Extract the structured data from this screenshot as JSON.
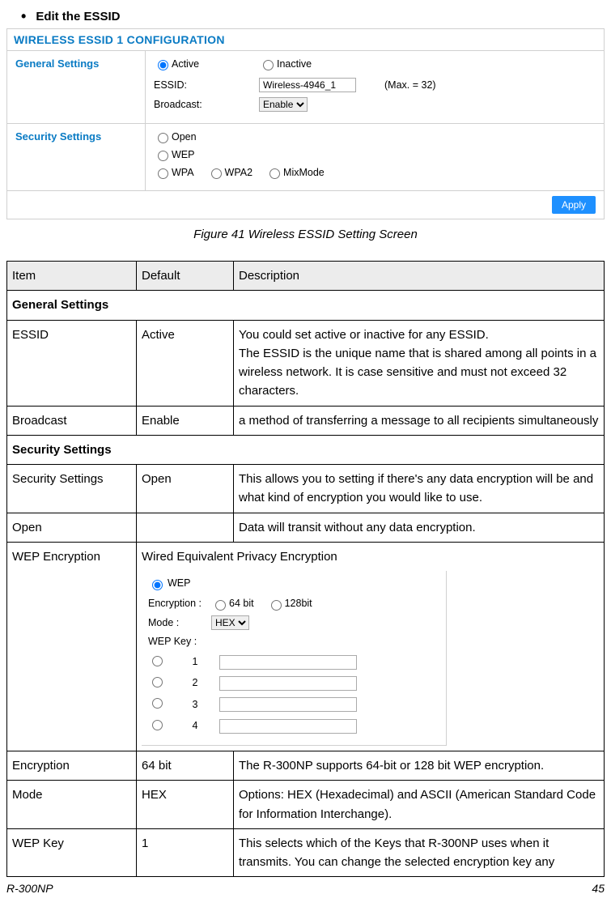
{
  "page": {
    "heading": "Edit the ESSID",
    "panelTitle": "WIRELESS ESSID 1 CONFIGURATION",
    "figureCaption": "Figure 41 Wireless ESSID Setting Screen",
    "footerLeft": "R-300NP",
    "footerRight": "45"
  },
  "settings": {
    "general": {
      "section": "General Settings",
      "activeLabel": "Active",
      "inactiveLabel": "Inactive",
      "essidLabel": "ESSID:",
      "essidValue": "Wireless-4946_1",
      "essidHint": "(Max. = 32)",
      "broadcastLabel": "Broadcast:",
      "broadcastValue": "Enable"
    },
    "security": {
      "section": "Security Settings",
      "open": "Open",
      "wep": "WEP",
      "wpa": "WPA",
      "wpa2": "WPA2",
      "mix": "MixMode"
    },
    "applyLabel": "Apply"
  },
  "table": {
    "headers": {
      "item": "Item",
      "default": "Default",
      "desc": "Description"
    },
    "generalSection": "General Settings",
    "rows": {
      "essid": {
        "item": "ESSID",
        "def": "Active",
        "desc": "You could set active or inactive for any ESSID.\nThe ESSID is the unique name that is shared among all points in a wireless network. It is case sensitive and must not exceed 32 characters."
      },
      "broadcast": {
        "item": "Broadcast",
        "def": "Enable",
        "desc": "a method of transferring a message to all recipients simultaneously"
      }
    },
    "securitySection": "Security Settings",
    "secRows": {
      "sec": {
        "item": "Security Settings",
        "def": "Open",
        "desc": "This allows you to setting if there's any data encryption will be and what kind of encryption you would like to use."
      },
      "open": {
        "item": "Open",
        "def": "",
        "desc": "Data will transit without any data encryption."
      },
      "wepEnc": {
        "item": "WEP Encryption",
        "title": "Wired Equivalent Privacy Encryption"
      },
      "encryption": {
        "item": "Encryption",
        "def": "64 bit",
        "desc": "The R-300NP supports 64-bit or 128 bit WEP encryption."
      },
      "mode": {
        "item": "Mode",
        "def": "HEX",
        "desc": "Options: HEX (Hexadecimal) and ASCII (American Standard Code for Information Interchange)."
      },
      "wepKey": {
        "item": "WEP Key",
        "def": "1",
        "desc": "This selects which of the Keys that R-300NP uses when it transmits. You can change the selected encryption key any"
      }
    }
  },
  "wepPanel": {
    "wepLabel": "WEP",
    "encLabel": "Encryption :",
    "enc64": "64 bit",
    "enc128": "128bit",
    "modeLabel": "Mode :",
    "modeValue": "HEX",
    "keyLabel": "WEP Key :",
    "keys": [
      "1",
      "2",
      "3",
      "4"
    ]
  }
}
